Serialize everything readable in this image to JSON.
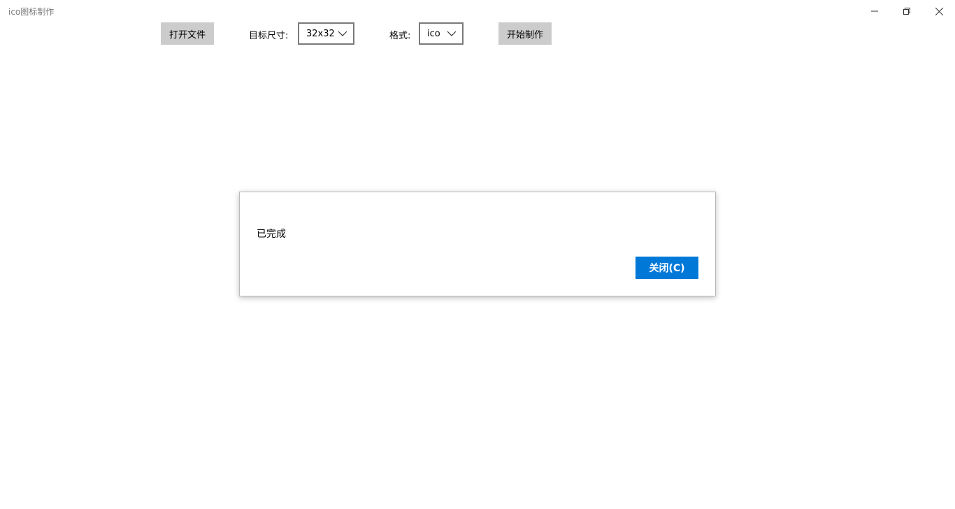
{
  "window": {
    "title": "ico图标制作",
    "controls": {
      "minimize_icon": "minimize-icon",
      "maximize_icon": "restore-icon",
      "close_icon": "close-icon"
    }
  },
  "toolbar": {
    "open_file_label": "打开文件",
    "target_size_label": "目标尺寸:",
    "target_size_value": "32x32",
    "format_label": "格式:",
    "format_value": "ico",
    "start_label": "开始制作"
  },
  "dialog": {
    "message": "已完成",
    "close_label": "关闭(C)",
    "accent_color": "#0078d7"
  },
  "colors": {
    "button_gray": "#cccccc",
    "title_text": "#777777"
  }
}
